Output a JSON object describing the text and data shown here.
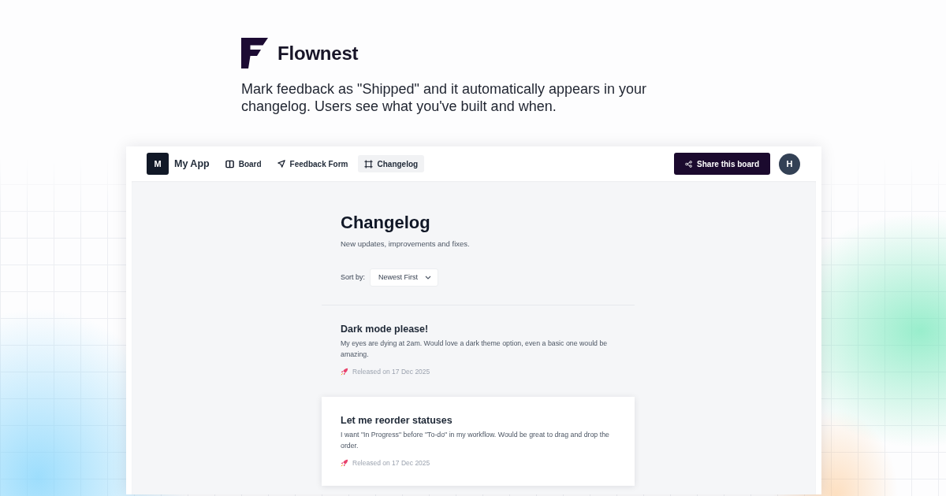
{
  "brand": {
    "name": "Flownest",
    "tagline": "Mark feedback as \"Shipped\" and it automatically appears in your changelog. Users see what you've built and when."
  },
  "app": {
    "nav": {
      "app_badge": "M",
      "app_name": "My App",
      "tabs": [
        {
          "label": "Board",
          "kind": "board",
          "selected": false
        },
        {
          "label": "Feedback Form",
          "kind": "form",
          "selected": false
        },
        {
          "label": "Changelog",
          "kind": "changelog",
          "selected": true
        }
      ]
    },
    "share_button": "Share this board",
    "avatar": "H"
  },
  "changelog": {
    "title": "Changelog",
    "subtitle": "New updates, improvements and fixes.",
    "sort": {
      "label": "Sort by:",
      "value": "Newest First"
    },
    "entries": [
      {
        "title": "Dark mode please!",
        "description": "My eyes are dying at 2am. Would love a dark theme option, even a basic one would be amazing.",
        "released": "Released on 17 Dec 2025",
        "highlighted": false
      },
      {
        "title": "Let me reorder statuses",
        "description": "I want \"In Progress\" before \"To-do\" in my workflow. Would be great to drag and drop the order.",
        "released": "Released on 17 Dec 2025",
        "highlighted": true
      }
    ]
  }
}
